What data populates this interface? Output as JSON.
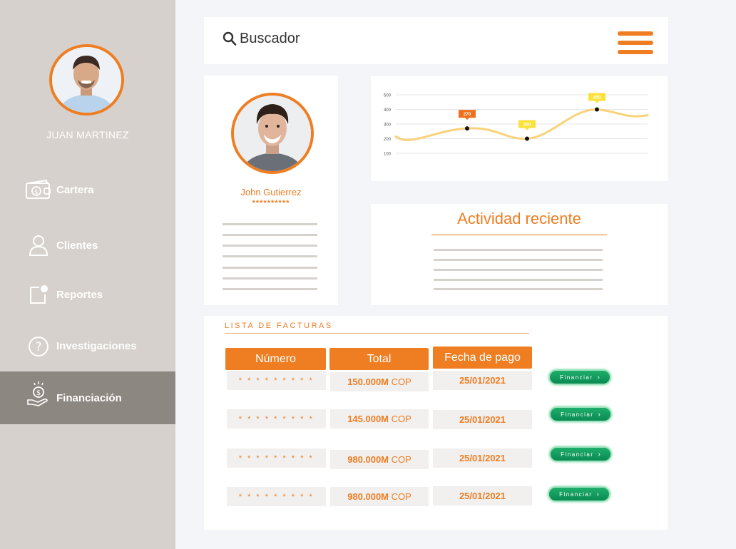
{
  "sidebar": {
    "user_name": "JUAN MARTINEZ",
    "items": [
      {
        "label": "Cartera",
        "icon": "wallet-icon"
      },
      {
        "label": "Clientes",
        "icon": "user-icon"
      },
      {
        "label": "Reportes",
        "icon": "report-icon"
      },
      {
        "label": "Investigaciones",
        "icon": "question-icon"
      },
      {
        "label": "Financiación",
        "icon": "hand-coin-icon",
        "active": true
      }
    ]
  },
  "header": {
    "search_label": "Buscador"
  },
  "profile": {
    "name": "John Gutierrez",
    "masked": "**********"
  },
  "chart_data": {
    "type": "line",
    "y_ticks": [
      "500",
      "400",
      "300",
      "200",
      "100"
    ],
    "points": [
      {
        "label": "270",
        "value": 270
      },
      {
        "label": "200",
        "value": 200
      },
      {
        "label": "400",
        "value": 400
      }
    ],
    "colors": {
      "line": "#f9d27a",
      "label_orange": "#ef6f1d",
      "label_yellow": "#fbe13a"
    }
  },
  "activity": {
    "title": "Actividad reciente"
  },
  "invoices": {
    "title": "LISTA DE FACTURAS",
    "headers": [
      "Número",
      "Total",
      "Fecha de pago"
    ],
    "rows": [
      {
        "numero": "* * * * * * * * *",
        "amount": "150.000M",
        "currency": "COP",
        "fecha": "25/01/2021",
        "action": "Financiar"
      },
      {
        "numero": "* * * * * * * * *",
        "amount": "145.000M",
        "currency": "COP",
        "fecha": "25/01/2021",
        "action": "Financiar"
      },
      {
        "numero": "* * * * * * * * *",
        "amount": "980.000M",
        "currency": "COP",
        "fecha": "25/01/2021",
        "action": "Financiar"
      },
      {
        "numero": "* * * * * * * * *",
        "amount": "980.000M",
        "currency": "COP",
        "fecha": "25/01/2021",
        "action": "Financiar"
      }
    ]
  },
  "colors": {
    "accent": "#ef7d22",
    "sidebar": "#d6d1cc",
    "sidebar_active": "#8d8781",
    "button_green": "#0a8a52"
  }
}
